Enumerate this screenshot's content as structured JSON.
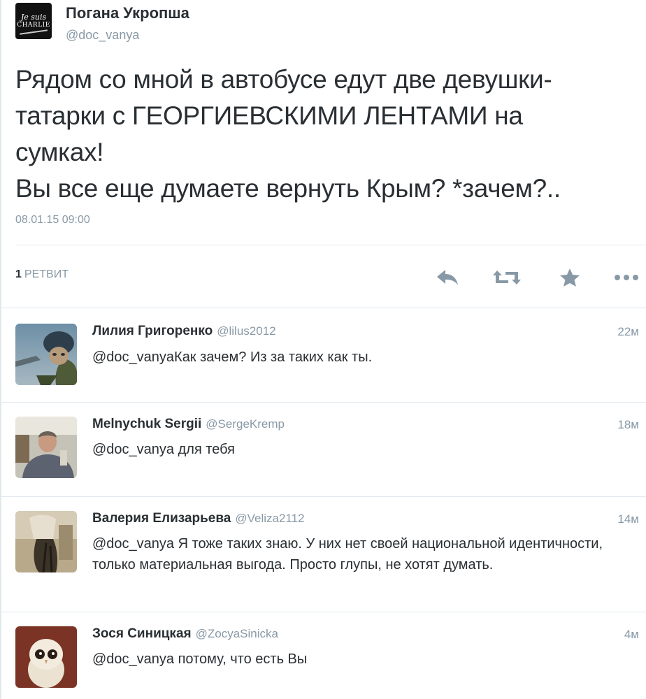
{
  "author": {
    "name": "Погана Укропша",
    "handle": "@doc_vanya",
    "avatar_line1": "Je suis",
    "avatar_line2": "CHARLIE"
  },
  "tweet": {
    "text": "Рядом со мной в автобусе едут две девушки-\nтатарки с ГЕОРГИЕВСКИМИ ЛЕНТАМИ на\nсумках!\nВы все еще думаете вернуть Крым?  *зачем?..",
    "timestamp": "08.01.15 09:00"
  },
  "stats": {
    "retweet_count": "1",
    "retweet_label": "РЕТВИТ"
  },
  "actions": [
    {
      "name": "reply",
      "icon": "reply-icon"
    },
    {
      "name": "retweet",
      "icon": "retweet-icon"
    },
    {
      "name": "favorite",
      "icon": "star-icon"
    },
    {
      "name": "more",
      "icon": "more-icon"
    }
  ],
  "colors": {
    "text": "#292f33",
    "secondary": "#8899a6",
    "action_icon": "#8899a6",
    "divider": "#e1e8ed"
  },
  "replies": [
    {
      "name": "Лилия Григоренко",
      "handle": "@lilus2012",
      "time": "22м",
      "text": "@doc_vanyaКак зачем? Из за таких как ты.",
      "avatar": "cat-pilot-avatar"
    },
    {
      "name": "Melnychuk Sergii",
      "handle": "@SergeKremp",
      "time": "18м",
      "text": "@doc_vanya для тебя",
      "avatar": "man-photo-avatar"
    },
    {
      "name": "Валерия Елизарьева",
      "handle": "@Veliza2112",
      "time": "14м",
      "text": "@doc_vanya Я тоже таких знаю. У них нет своей национальной идентичности, только материальная выгода. Просто глупы, не хотят думать.",
      "avatar": "sepia-photo-avatar"
    },
    {
      "name": "Зося Синицкая",
      "handle": "@ZocyaSinicka",
      "time": "4м",
      "text": "@doc_vanya потому, что есть Вы",
      "avatar": "owl-avatar"
    }
  ]
}
